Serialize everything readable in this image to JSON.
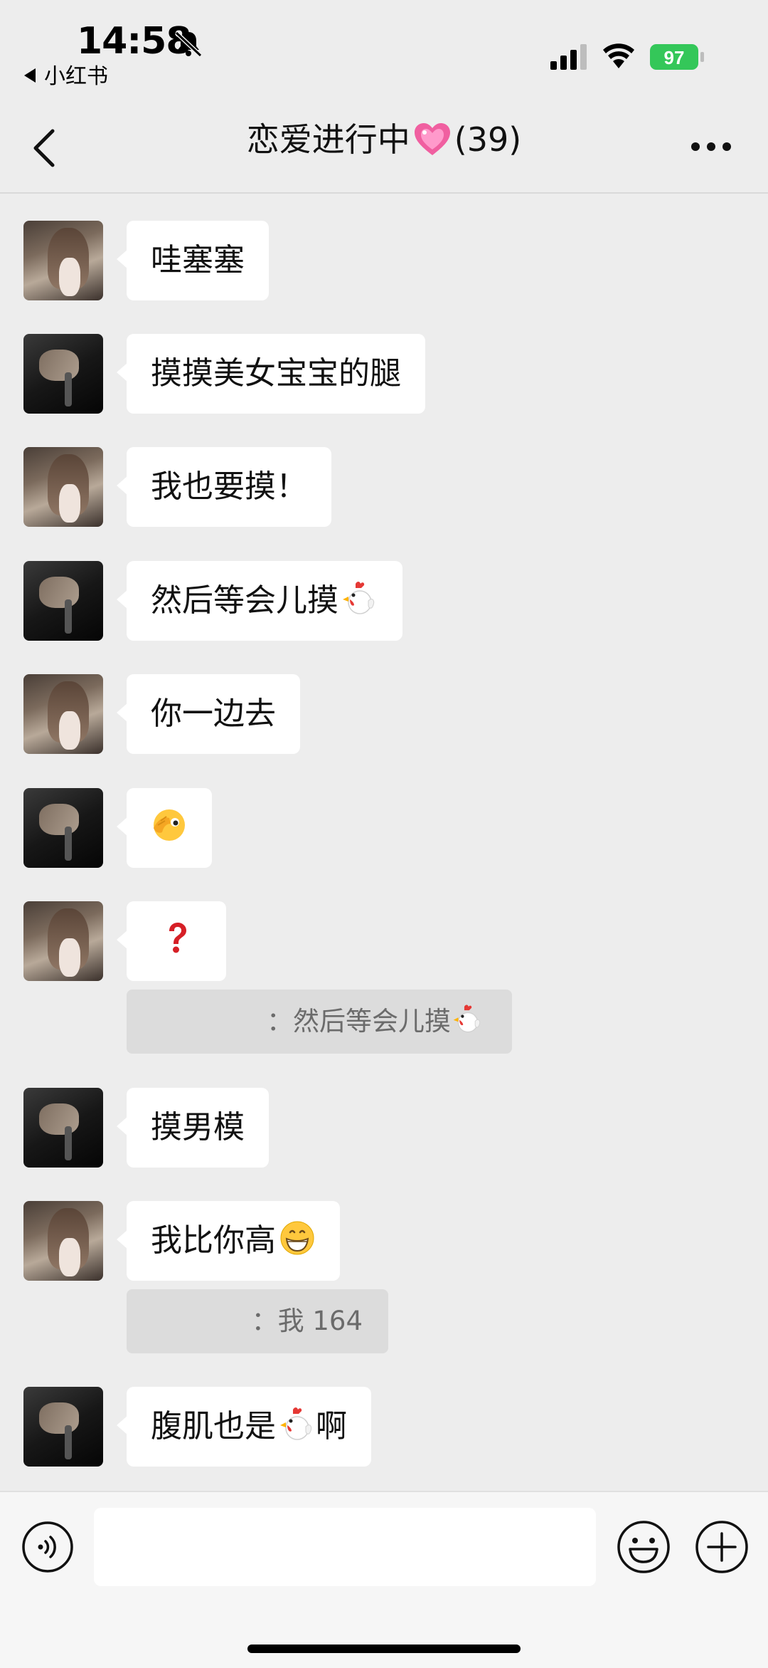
{
  "status_bar": {
    "time": "14:58",
    "back_app": "小红书",
    "battery": "97"
  },
  "nav": {
    "title_prefix": "恋爱进行中",
    "title_suffix": "(39)",
    "heart_icon": "pink-sparkling-heart-icon"
  },
  "messages": [
    {
      "sender": "girl",
      "text": "哇塞塞"
    },
    {
      "sender": "boy",
      "text": "摸摸美女宝宝的腿"
    },
    {
      "sender": "girl",
      "text": "我也要摸！"
    },
    {
      "sender": "boy",
      "text": "然后等会儿摸",
      "emoji": "rooster-icon"
    },
    {
      "sender": "girl",
      "text": "你一边去"
    },
    {
      "sender": "boy",
      "text": "",
      "emoji": "peeking-face-icon"
    },
    {
      "sender": "girl",
      "text": "",
      "emoji": "red-question-mark-icon",
      "quote": {
        "text": "：然后等会儿摸",
        "emoji": "rooster-icon"
      }
    },
    {
      "sender": "boy",
      "text": "摸男模"
    },
    {
      "sender": "girl",
      "text": "我比你高",
      "emoji": "grinning-face-icon",
      "quote": {
        "text": "：我 164"
      }
    },
    {
      "sender": "boy",
      "text": "腹肌也是",
      "emoji": "rooster-icon",
      "text_after": "啊"
    }
  ],
  "input": {
    "placeholder": ""
  },
  "colors": {
    "background": "#EDEDED",
    "bubble": "#FFFFFF",
    "quote": "#DCDCDC",
    "battery": "#34C759"
  }
}
